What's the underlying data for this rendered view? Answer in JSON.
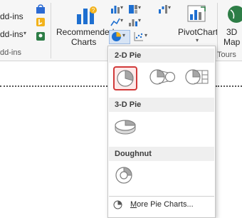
{
  "ribbon": {
    "addins_top": "dd-ins",
    "addins_mid": "dd-ins",
    "addins_group": "dd-ins",
    "recommended_line1": "Recommended",
    "recommended_line2": "Charts",
    "pivotchart": "PivotChart",
    "map_line1": "3D",
    "map_line2": "Map",
    "tours_group": "Tours"
  },
  "dropdown": {
    "section_2d": "2-D Pie",
    "section_3d": "3-D Pie",
    "section_doughnut": "Doughnut",
    "more_pie_prefix": "M",
    "more_pie_rest": "ore Pie Charts..."
  },
  "colors": {
    "selection_border": "#d23a3a",
    "accent_blue": "#1e6fd0",
    "pie_gray": "#7f7f7f"
  },
  "icons": [
    "store-icon",
    "bing-icon",
    "recommended-charts-icon",
    "column-chart-icon",
    "hierarchy-chart-icon",
    "waterfall-chart-icon",
    "line-chart-icon",
    "statistic-chart-icon",
    "pie-chart-icon",
    "scatter-chart-icon",
    "pivotchart-icon",
    "3d-map-icon"
  ]
}
